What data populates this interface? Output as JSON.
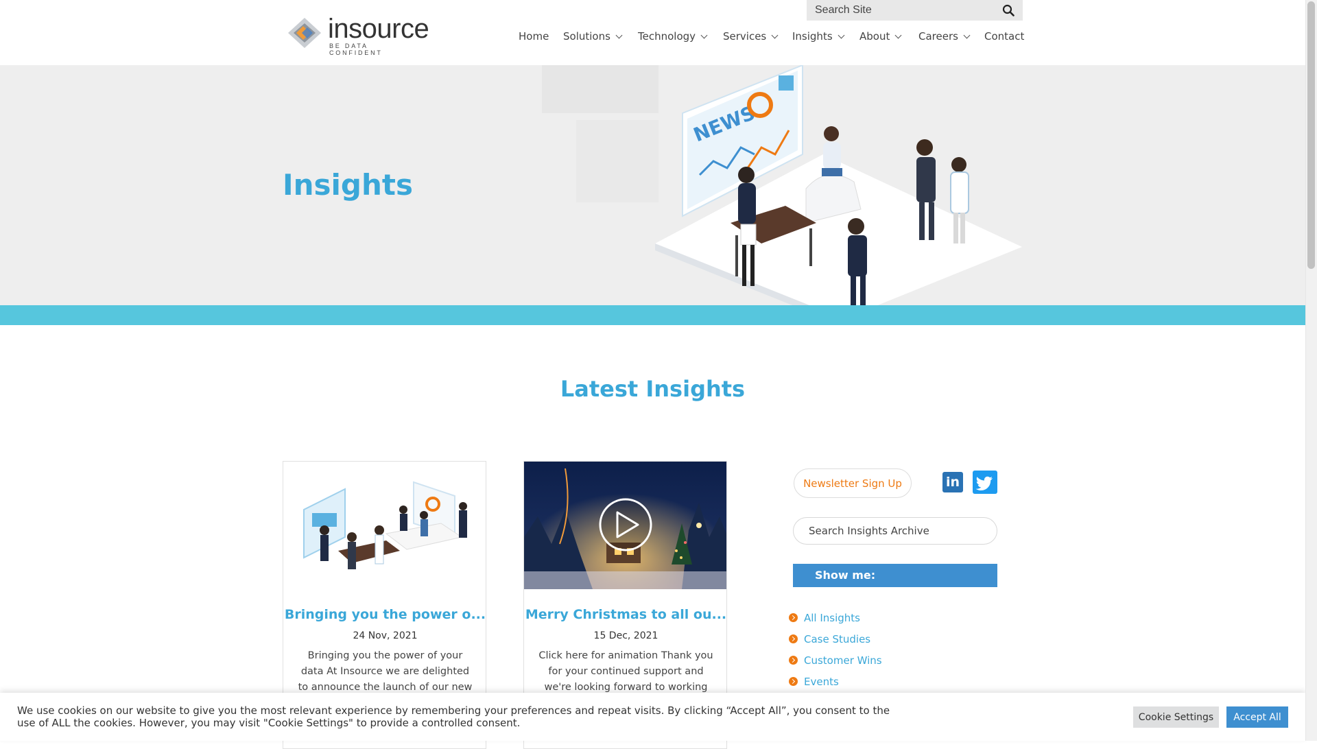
{
  "header": {
    "logo_word": "insource",
    "logo_tagline": "BE DATA CONFIDENT",
    "search_placeholder": "Search Site",
    "nav": [
      {
        "label": "Home",
        "dropdown": false
      },
      {
        "label": "Solutions",
        "dropdown": true
      },
      {
        "label": "Technology",
        "dropdown": true
      },
      {
        "label": "Services",
        "dropdown": true
      },
      {
        "label": "Insights",
        "dropdown": true
      },
      {
        "label": "About",
        "dropdown": true
      },
      {
        "label": "Careers",
        "dropdown": true
      },
      {
        "label": "Contact",
        "dropdown": false
      }
    ]
  },
  "hero": {
    "title": "Insights",
    "illustration_text": "NEWS"
  },
  "section": {
    "title": "Latest Insights"
  },
  "cards": [
    {
      "title": "Bringing you the power o...",
      "date": "24 Nov, 2021",
      "excerpt": "Bringing you the power of your data At Insource we are delighted to announce the launch of our new"
    },
    {
      "title": "Merry Christmas to all ou...",
      "date": "15 Dec, 2021",
      "excerpt": "Click here for animation Thank you for your continued support and we're looking forward to working"
    }
  ],
  "sidebar": {
    "newsletter_label": "Newsletter Sign Up",
    "linkedin_label": "in",
    "archive_search_placeholder": "Search Insights Archive",
    "show_me_label": "Show me:",
    "categories": [
      "All Insights",
      "Case Studies",
      "Customer Wins",
      "Events"
    ]
  },
  "cookie": {
    "text": "We use cookies on our website to give you the most relevant experience by remembering your preferences and repeat visits. By clicking “Accept All”, you consent to the use of ALL the cookies. However, you may visit \"Cookie Settings\" to provide a controlled consent.",
    "settings_label": "Cookie Settings",
    "accept_label": "Accept All"
  },
  "colors": {
    "accent_blue": "#3aa7d8",
    "band_teal": "#56c6dd",
    "button_blue": "#3e8fd0",
    "orange": "#ee7a13"
  }
}
